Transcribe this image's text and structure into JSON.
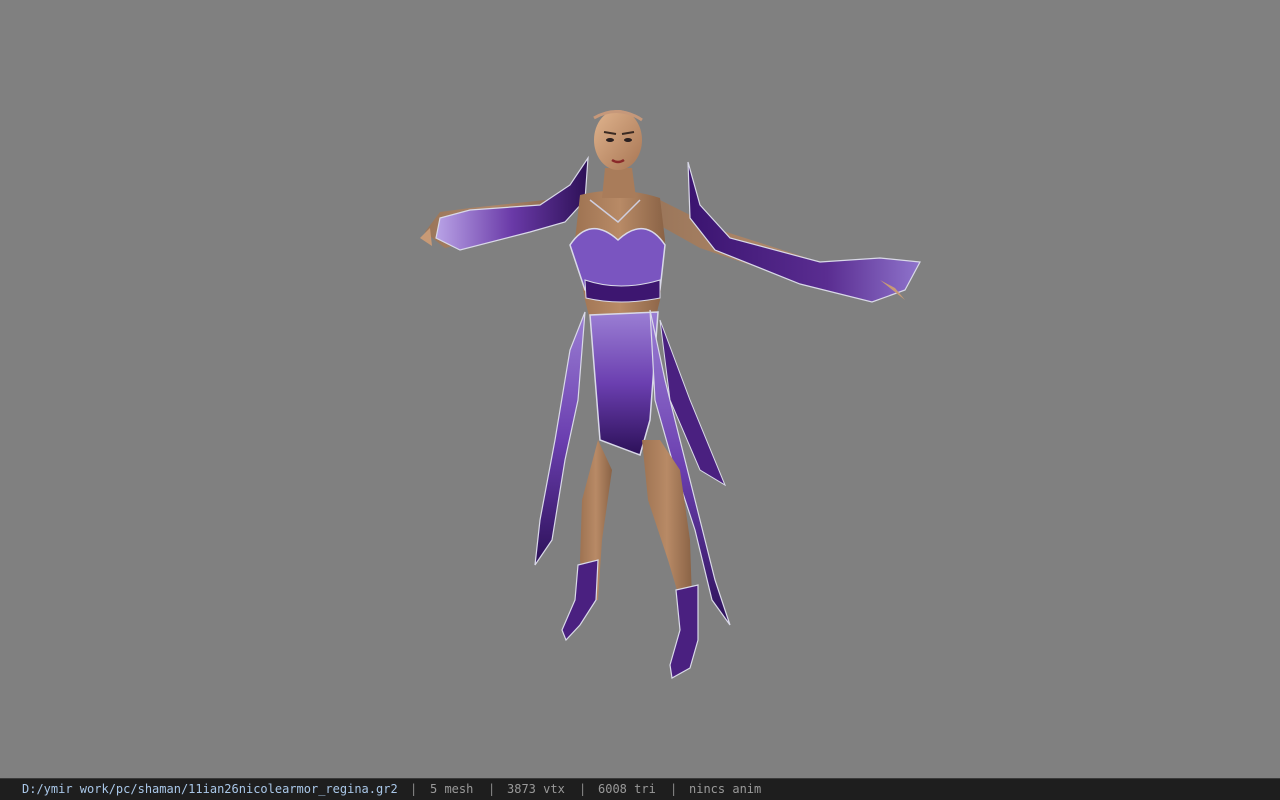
{
  "status_bar": {
    "file_path": "D:/ymir work/pc/shaman/11ian26nicolearmor_regina.gr2",
    "separator": "|",
    "mesh_count": "5 mesh",
    "vertex_count": "3873 vtx",
    "triangle_count": "6008 tri",
    "anim_status": "nincs anim"
  },
  "colors": {
    "viewport_background": "#808080",
    "status_background": "#1e1e1e",
    "path_text": "#a9c7e8",
    "stat_text": "#9a9a9a",
    "armor_purple": "#5a2d91",
    "armor_light": "#9b7fd4",
    "skin": "#b88a66"
  }
}
